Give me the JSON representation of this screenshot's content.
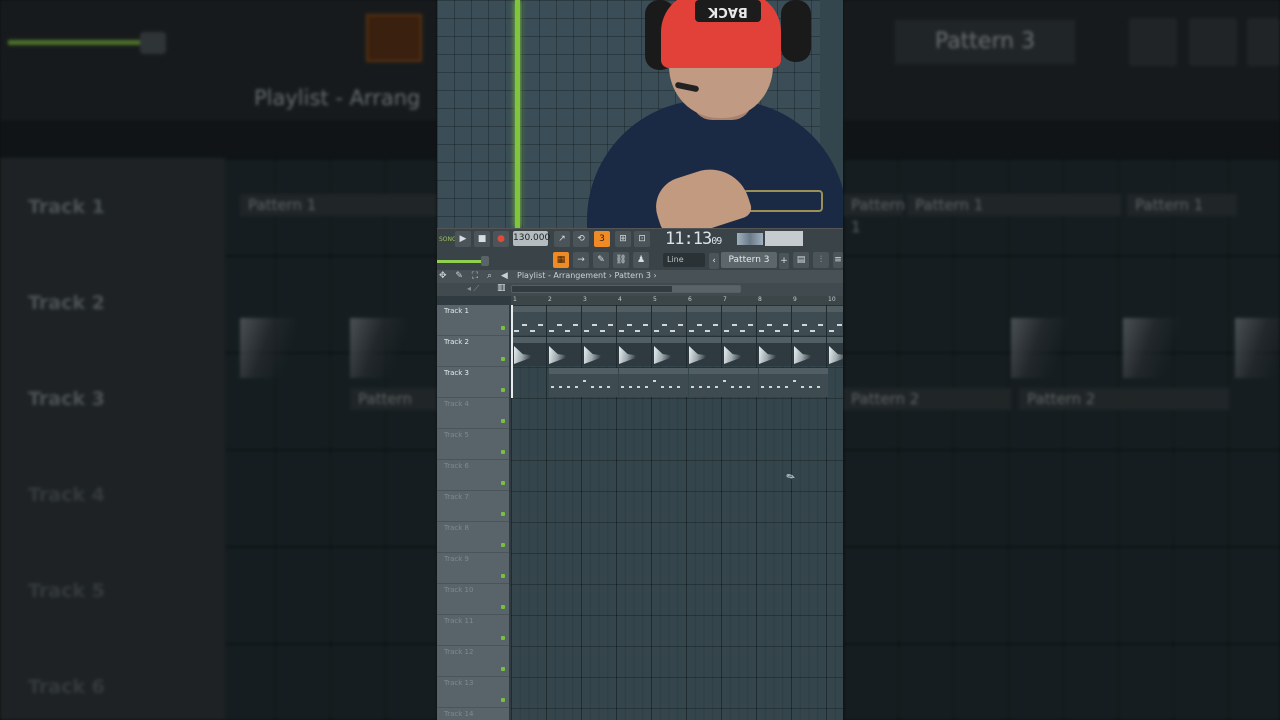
{
  "playlist": {
    "title": "Playlist - Arrangement",
    "breadcrumb": "Pattern 3",
    "tracks": [
      "Track 1",
      "Track 2",
      "Track 3",
      "Track 4",
      "Track 5",
      "Track 6",
      "Track 7",
      "Track 8",
      "Track 9",
      "Track 10",
      "Track 11",
      "Track 12",
      "Track 13",
      "Track 14"
    ],
    "bar_numbers": [
      "1",
      "2",
      "3",
      "4",
      "5",
      "6",
      "7",
      "8",
      "9",
      "10"
    ],
    "clip_pattern1": "Pattern 1",
    "clip_pattern2": "Pattern 2"
  },
  "toolbar": {
    "song_label": "SONG",
    "tempo": "130.000",
    "time": "11:13",
    "time_frac": "09",
    "snap": "Line",
    "pattern": "Pattern 3"
  },
  "webcam": {
    "hat_text": "BACK"
  },
  "background": {
    "pattern": "Pattern 3",
    "playlist_title": "Playlist - Arrang",
    "tracks_left": [
      "Track 1",
      "Track 2",
      "Track 3",
      "Track 4",
      "Track 5",
      "Track 6"
    ],
    "clip_pattern1": "Pattern 1",
    "clip_pattern2": "Pattern 2",
    "clip_pattern_short": "Pattern"
  },
  "colors": {
    "accent_green": "#7fc63a",
    "accent_orange": "#f08a24",
    "hat_red": "#e2413a"
  }
}
